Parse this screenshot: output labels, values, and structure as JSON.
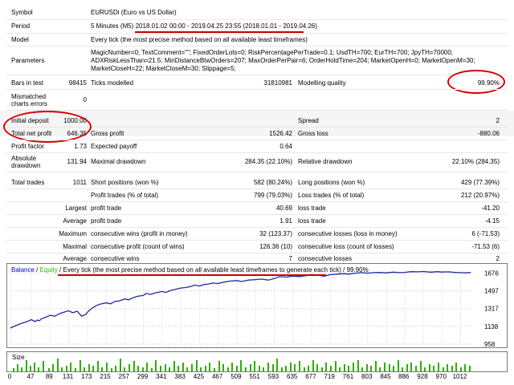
{
  "colors": {
    "balance_line": "#1f2a9e",
    "volume_bar": "#2db000",
    "annotation_red": "#c80000",
    "grid": "#d9d9d9"
  },
  "header": {
    "symbol_label": "Symbol",
    "symbol_value": "EURUSDi (Euro vs US Dollar)",
    "period_label": "Period",
    "period_value_prefix": "5 Minutes (M5)",
    "period_value_dates": "2018.01.02 00:00 - 2019.04.25 23:55",
    "period_value_range": "(2018.01.01 - 2019.04.26)",
    "model_label": "Model",
    "model_value": "Every tick (the most precise method based on all available least timeframes)",
    "parameters_label": "Parameters",
    "parameters_line1": "MagicNumber=0; TextComment=\"\"; FixedOrderLots=0; RiskPercentagePerTrade=0.1; UsdTH=700; EurTH=700; JpyTH=70000;",
    "parameters_line2": "ADXRiskLessThan=21.5; MinDistanceBtwOrders=207; MaxOrderPerPair=6; OrderHoldTime=204; MarketOpenH=0; MarketOpenM=30;",
    "parameters_line3": "MarketCloseH=22; MarketCloseM=30; Slippage=5;"
  },
  "stats": {
    "bars_label": "Bars in test",
    "bars_value": "98415",
    "ticks_label": "Ticks modelled",
    "ticks_value": "31810981",
    "quality_label": "Modelling quality",
    "quality_value": "99.90%",
    "mismatched_label_1": "Mismatched",
    "mismatched_label_2": "charts errors",
    "mismatched_value": "0",
    "initial_deposit_label": "Initial deposit",
    "initial_deposit_value": "1000.00",
    "spread_label": "Spread",
    "spread_value": "2",
    "net_profit_label": "Total net profit",
    "net_profit_value": "646.35",
    "gross_profit_label": "Gross profit",
    "gross_profit_value": "1526.42",
    "gross_loss_label": "Gross loss",
    "gross_loss_value": "-880.06",
    "profit_factor_label": "Profit factor",
    "profit_factor_value": "1.73",
    "expected_payoff_label": "Expected payoff",
    "expected_payoff_value": "0.64",
    "abs_drawdown_label_1": "Absolute",
    "abs_drawdown_label_2": "drawdown",
    "abs_drawdown_value": "131.94",
    "max_drawdown_label": "Maximal drawdown",
    "max_drawdown_value": "284.35 (22.10%)",
    "rel_drawdown_label": "Relative drawdown",
    "rel_drawdown_value": "22.10% (284.35)",
    "total_trades_label": "Total trades",
    "total_trades_value": "1011",
    "short_label": "Short positions (won %)",
    "short_value": "582 (80.24%)",
    "long_label": "Long positions (won %)",
    "long_value": "429 (77.39%)",
    "profit_trades_label": "Profit trades (% of total)",
    "profit_trades_value": "799 (79.03%)",
    "loss_trades_label": "Loss trades (% of total)",
    "loss_trades_value": "212 (20.97%)",
    "largest_label": "Largest",
    "largest_profit_label": "profit trade",
    "largest_profit_value": "40.69",
    "largest_loss_label": "loss trade",
    "largest_loss_value": "-41.20",
    "average_label": "Average",
    "average_profit_label": "profit trade",
    "average_profit_value": "1.91",
    "average_loss_label": "loss trade",
    "average_loss_value": "-4.15",
    "maximum_label": "Maximum",
    "max_cons_wins_label": "consecutive wins (profit in money)",
    "max_cons_wins_value": "32 (123.37)",
    "max_cons_losses_label": "consecutive losses (loss in money)",
    "max_cons_losses_value": "6 (-71.53)",
    "maximal_label": "Maximal",
    "maximal_cons_profit_label": "consecutive profit (count of wins)",
    "maximal_cons_profit_value": "126.36 (10)",
    "maximal_cons_loss_label": "consecutive loss (count of losses)",
    "maximal_cons_loss_value": "-71.53 (6)",
    "average2_label": "Average",
    "avg_cons_wins_label": "consecutive wins",
    "avg_cons_wins_value": "7",
    "avg_cons_losses_label": "consecutive losses",
    "avg_cons_losses_value": "2"
  },
  "chart_legend": {
    "balance": "Balance",
    "sep1": " / ",
    "equity": "Equity",
    "sep2": " / ",
    "description": "Every tick (the most precise method based on all available least timeframes to generate each tick)",
    "sep3": " / ",
    "quality": "99.90%"
  },
  "volume_label": "Size",
  "chart_data": {
    "type": "line",
    "title": "",
    "xlabel": "",
    "ylabel": "",
    "x_ticks": [
      "0",
      "47",
      "89",
      "131",
      "173",
      "215",
      "257",
      "299",
      "341",
      "383",
      "425",
      "467",
      "509",
      "551",
      "593",
      "635",
      "677",
      "719",
      "761",
      "803",
      "845",
      "886",
      "928",
      "970",
      "1012"
    ],
    "y_ticks": [
      "1676",
      "1497",
      "1317",
      "1138",
      "958"
    ],
    "ylim": [
      958,
      1720
    ],
    "xlim": [
      0,
      1040
    ],
    "series": [
      {
        "x": [
          0,
          10,
          20,
          30,
          40,
          47,
          55,
          60,
          65,
          70,
          80,
          89,
          100,
          110,
          120,
          131,
          140,
          150,
          160,
          170,
          173,
          180,
          190,
          200,
          215,
          225,
          235,
          245,
          257,
          265,
          275,
          285,
          299,
          305,
          315,
          325,
          341,
          350,
          360,
          370,
          383,
          395,
          405,
          415,
          425,
          435,
          445,
          455,
          467,
          480,
          495,
          509,
          520,
          535,
          551,
          565,
          580,
          593,
          605,
          620,
          635,
          650,
          665,
          677,
          690,
          705,
          719,
          735,
          750,
          761,
          775,
          790,
          803,
          815,
          830,
          845,
          860,
          875,
          886,
          900,
          915,
          928,
          945,
          960,
          970,
          985,
          1000,
          1012,
          1025,
          1035
        ],
        "values": [
          1120,
          1140,
          1160,
          1175,
          1190,
          1205,
          1185,
          1200,
          1195,
          1215,
          1230,
          1250,
          1240,
          1265,
          1280,
          1295,
          1275,
          1290,
          1240,
          1260,
          1280,
          1310,
          1340,
          1360,
          1375,
          1365,
          1390,
          1395,
          1415,
          1405,
          1425,
          1440,
          1450,
          1470,
          1460,
          1475,
          1490,
          1480,
          1500,
          1510,
          1525,
          1530,
          1540,
          1555,
          1545,
          1560,
          1565,
          1575,
          1570,
          1585,
          1595,
          1600,
          1590,
          1605,
          1610,
          1615,
          1605,
          1620,
          1640,
          1635,
          1645,
          1640,
          1650,
          1660,
          1655,
          1645,
          1660,
          1665,
          1670,
          1665,
          1675,
          1680,
          1675,
          1680,
          1682,
          1678,
          1685,
          1680,
          1683,
          1690,
          1688,
          1692,
          1685,
          1690,
          1686,
          1688,
          1682,
          1680,
          1678,
          1682
        ]
      }
    ]
  },
  "volume_data": {
    "x": [
      3,
      9,
      14,
      20,
      26,
      31,
      37,
      43,
      50,
      56,
      62,
      68,
      74,
      80,
      86,
      92,
      98,
      104,
      110,
      116,
      122,
      128,
      134,
      140,
      146,
      152,
      158,
      164,
      170,
      176,
      182,
      188,
      194,
      200,
      206,
      212,
      218,
      224,
      230,
      236,
      242,
      248,
      254,
      260,
      266,
      272,
      278,
      284,
      290,
      296,
      302,
      308,
      314,
      320,
      326,
      332,
      338,
      344,
      350,
      356,
      362,
      368,
      374,
      380,
      386,
      392,
      398,
      404,
      410,
      416,
      422,
      428,
      434,
      440,
      446,
      452,
      458,
      464,
      470,
      476,
      482,
      488,
      494,
      500,
      506,
      512,
      518,
      524,
      530,
      536,
      542,
      548,
      554,
      560,
      566,
      572,
      578,
      584,
      590,
      596,
      602,
      608,
      614
    ],
    "values": [
      0.2,
      0.5,
      0.3,
      0.8,
      0.4,
      0.6,
      0.3,
      0.7,
      0.2,
      0.5,
      0.9,
      0.3,
      0.4,
      0.6,
      0.2,
      0.8,
      0.3,
      0.5,
      0.4,
      0.7,
      0.3,
      0.6,
      0.2,
      0.4,
      0.9,
      0.3,
      0.5,
      0.7,
      0.4,
      0.3,
      0.6,
      0.2,
      0.8,
      0.4,
      0.5,
      0.3,
      0.7,
      0.4,
      0.6,
      0.3,
      0.5,
      0.8,
      0.3,
      0.4,
      0.6,
      0.2,
      0.7,
      0.5,
      0.3,
      0.6,
      0.4,
      0.8,
      0.3,
      0.5,
      0.7,
      0.4,
      0.3,
      0.6,
      0.5,
      0.9,
      0.3,
      0.4,
      0.6,
      0.5,
      0.7,
      0.3,
      0.4,
      0.8,
      0.5,
      0.3,
      0.6,
      0.4,
      0.7,
      0.3,
      0.5,
      0.4,
      0.6,
      0.8,
      0.3,
      0.5,
      0.4,
      0.7,
      0.3,
      0.6,
      0.5,
      0.4,
      0.8,
      0.3,
      0.5,
      0.6,
      0.4,
      0.7,
      0.3,
      0.5,
      0.4,
      0.6,
      0.3,
      0.5,
      0.4,
      0.6,
      0.3,
      0.5,
      0.4
    ]
  }
}
